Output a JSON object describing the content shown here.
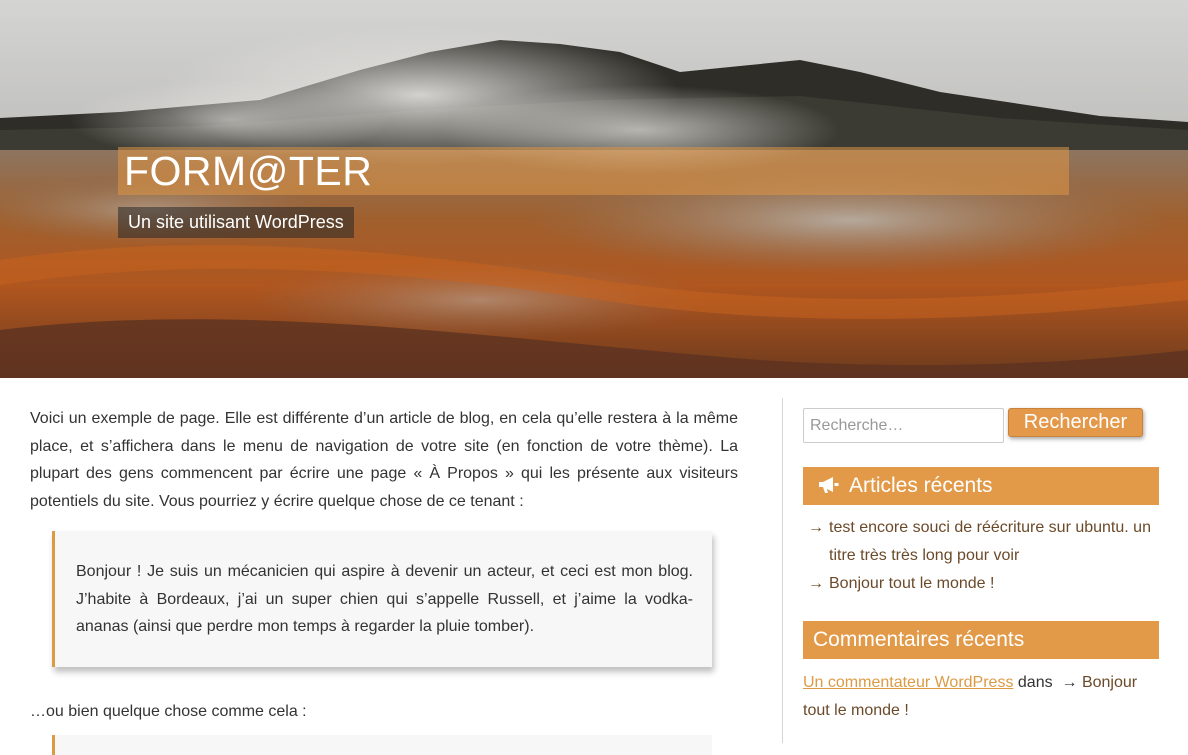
{
  "header": {
    "site_title": "FORM@TER",
    "tagline": "Un site utilisant WordPress"
  },
  "content": {
    "intro": "Voici un exemple de page. Elle est différente d’un article de blog, en cela qu’elle restera à la même place, et s’affichera dans le menu de navigation de votre site (en fonction de votre thème). La plupart des gens commencent par écrire une page « À Propos » qui les présente aux visiteurs potentiels du site. Vous pourriez y écrire quelque chose de ce tenant :",
    "quote": "Bonjour ! Je suis un mécanicien qui aspire à devenir un acteur, et ceci est mon blog. J’habite à Bordeaux, j’ai un super chien qui s’appelle Russell, et j’aime la vodka-ananas (ainsi que perdre mon temps à regarder la pluie tomber).",
    "outro": "…ou bien quelque chose comme cela :"
  },
  "sidebar": {
    "search": {
      "placeholder": "Recherche…",
      "button_label": "Rechercher"
    },
    "recent_posts": {
      "title": "Articles récents",
      "icon": "megaphone-icon",
      "arrow": "→",
      "items": [
        {
          "label": "test encore souci de réécriture sur ubuntu. un titre très très long pour voir"
        },
        {
          "label": "Bonjour tout le monde !"
        }
      ]
    },
    "recent_comments": {
      "title": "Commentaires récents",
      "author": "Un commentateur WordPress",
      "connector": "dans",
      "arrow": "→",
      "post": "Bonjour tout le monde !"
    }
  },
  "colors": {
    "accent": "#e29a48",
    "link": "#6b4a2a",
    "author_link": "#dd9a45",
    "text": "#333333"
  }
}
